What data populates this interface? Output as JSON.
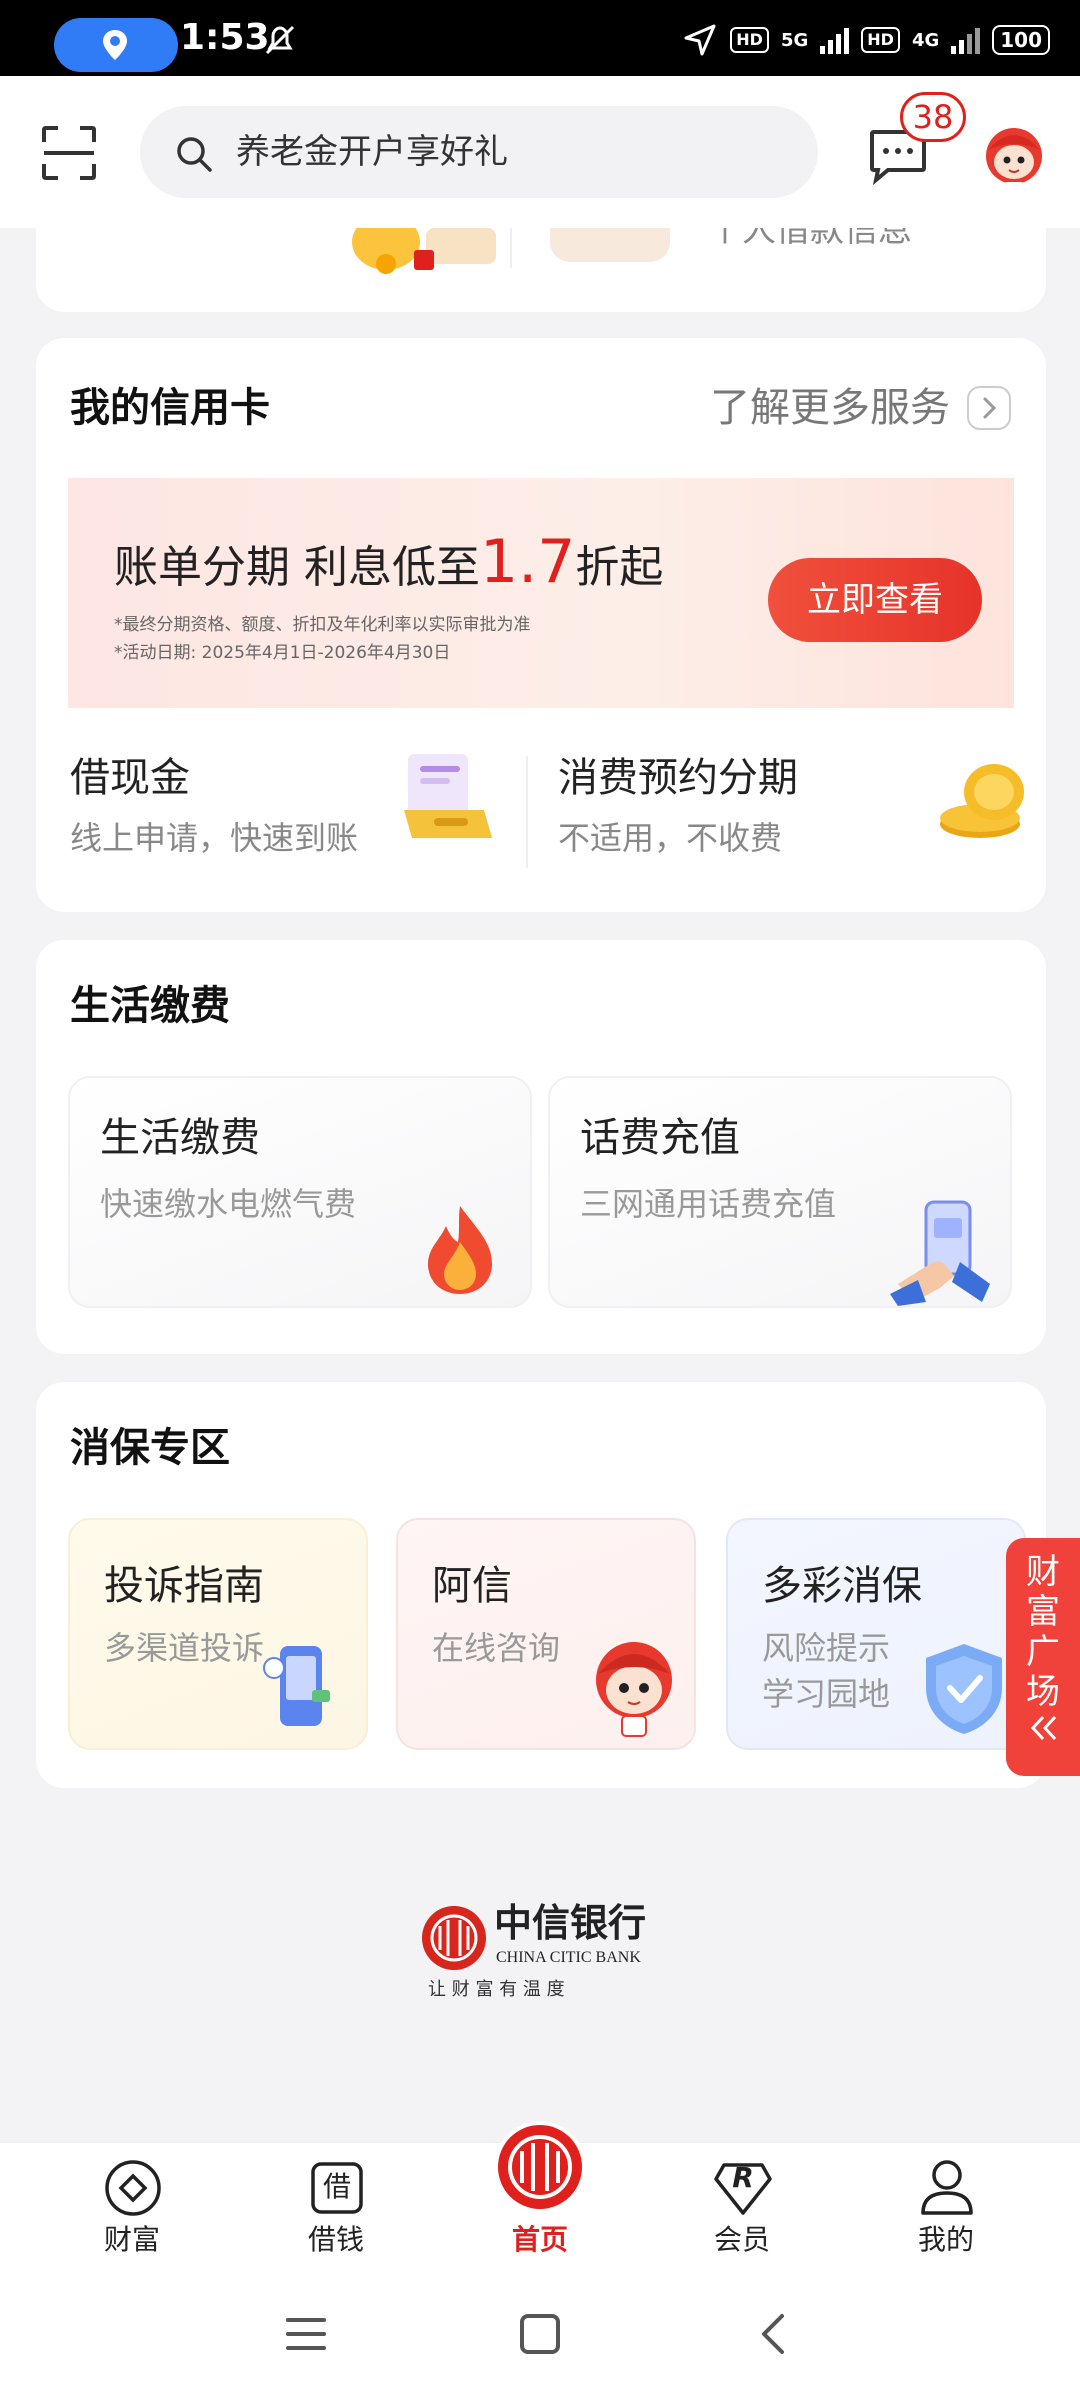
{
  "status_bar": {
    "time": "1:53",
    "network_5g": "5G",
    "network_4g": "4G",
    "hd": "HD",
    "battery": "100"
  },
  "header": {
    "search_text": "养老金开户享好礼",
    "message_count": "38"
  },
  "partial_top_card": {
    "text": "个人借款信息"
  },
  "credit_card": {
    "title": "我的信用卡",
    "more_link": "了解更多服务",
    "promo": {
      "text_before": "账单分期  利息低至",
      "number": "1.7",
      "text_after": "折起",
      "note1": "*最终分期资格、额度、折扣及年化利率以实际审批为准",
      "note2": "*活动日期: 2025年4月1日-2026年4月30日",
      "button": "立即查看"
    },
    "cash": {
      "title": "借现金",
      "subtitle": "线上申请，快速到账"
    },
    "installment": {
      "title": "消费预约分期",
      "subtitle": "不适用，不收费"
    }
  },
  "life": {
    "title": "生活缴费",
    "tiles": [
      {
        "title": "生活缴费",
        "subtitle": "快速缴水电燃气费"
      },
      {
        "title": "话费充值",
        "subtitle": "三网通用话费充值"
      }
    ]
  },
  "consumer": {
    "title": "消保专区",
    "tiles": [
      {
        "title": "投诉指南",
        "subtitle": "多渠道投诉"
      },
      {
        "title": "阿信",
        "subtitle": "在线咨询"
      },
      {
        "title": "多彩消保",
        "subtitle1": "风险提示",
        "subtitle2": "学习园地"
      }
    ]
  },
  "side_float": {
    "chars": [
      "财",
      "富",
      "广",
      "场"
    ]
  },
  "brand": {
    "name_cn": "中信银行",
    "name_en": "CHINA CITIC BANK",
    "slogan": "让 财 富 有 温 度"
  },
  "bottom_nav": {
    "items": [
      {
        "label": "财富"
      },
      {
        "label": "借钱",
        "icon_text": "借"
      },
      {
        "label": "首页"
      },
      {
        "label": "会员",
        "icon_text": "R"
      },
      {
        "label": "我的"
      }
    ]
  },
  "colors": {
    "accent_red": "#e0201c",
    "bg": "#f3f3f5"
  }
}
